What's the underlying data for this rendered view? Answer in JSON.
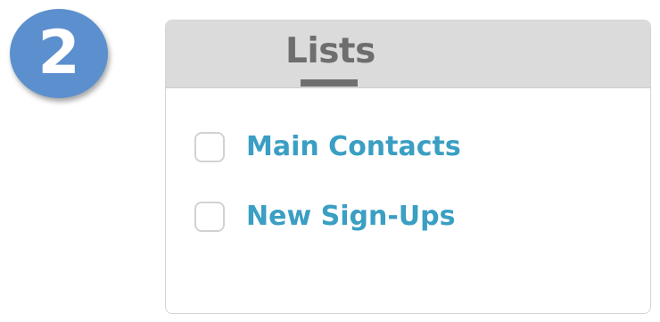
{
  "step": {
    "number": "2",
    "color": "#5b8fce"
  },
  "panel": {
    "tab_label": "Lists",
    "items": [
      {
        "label": "Main Contacts",
        "checked": false
      },
      {
        "label": "New Sign-Ups",
        "checked": false
      }
    ],
    "colors": {
      "header_bg": "#dcdbdc",
      "tab_text": "#6f6e6f",
      "item_text": "#3a9fc3"
    }
  }
}
